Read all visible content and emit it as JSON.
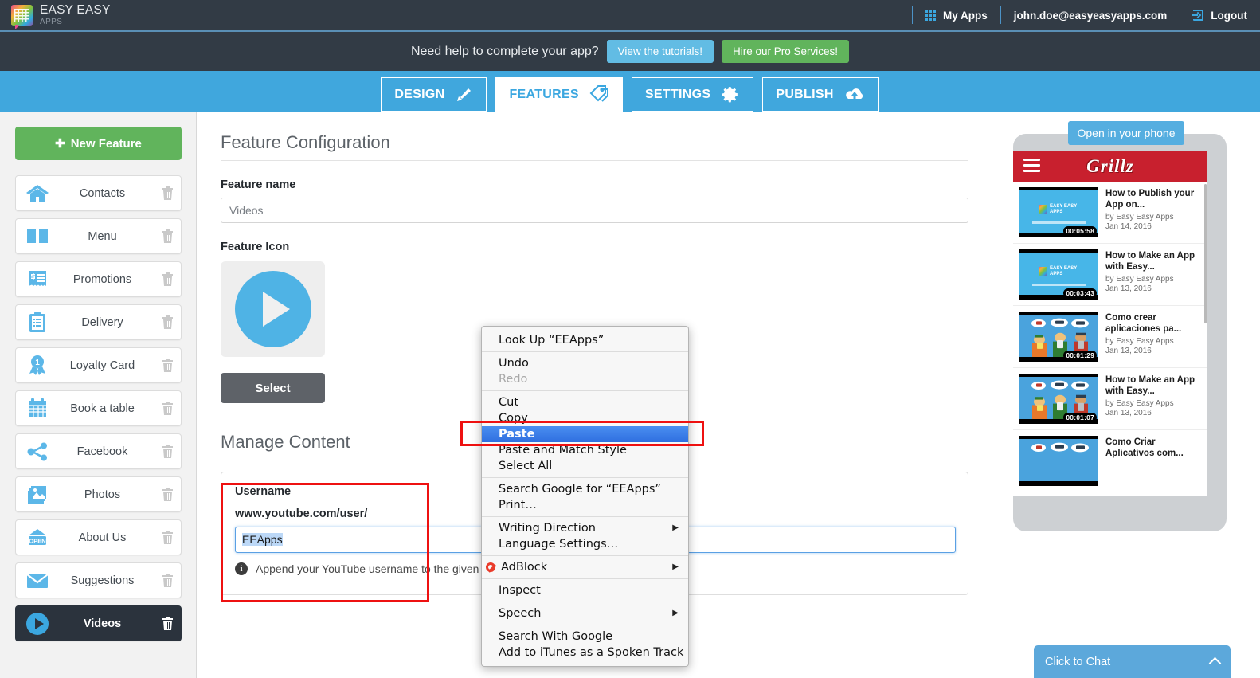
{
  "topbar": {
    "logo": {
      "line1": "EASY EASY",
      "line2": "APPS",
      "icon": "grid-logo-icon"
    },
    "my_apps": "My Apps",
    "my_apps_icon": "apps-grid-icon",
    "account_email": "john.doe@easyeasyapps.com",
    "logout": "Logout",
    "logout_icon": "logout-arrow-icon"
  },
  "helpbar": {
    "prompt": "Need help to complete your app?",
    "tutorials_button": "View the tutorials!",
    "pro_button": "Hire our Pro Services!",
    "tutorials_color": "#62bce4",
    "pro_color": "#61b45c"
  },
  "nav": {
    "tabs": [
      {
        "label": "DESIGN",
        "icon": "paintbrush-icon",
        "active": false
      },
      {
        "label": "FEATURES",
        "icon": "tags-icon",
        "active": true
      },
      {
        "label": "SETTINGS",
        "icon": "gear-icon",
        "active": false
      },
      {
        "label": "PUBLISH",
        "icon": "cloud-upload-icon",
        "active": false
      }
    ],
    "bar_color": "#40a7dd"
  },
  "sidebar": {
    "new_feature_button": "New Feature",
    "items": [
      {
        "label": "Contacts",
        "icon": "home-icon",
        "active": false
      },
      {
        "label": "Menu",
        "icon": "book-icon",
        "active": false
      },
      {
        "label": "Promotions",
        "icon": "receipt-dollar-icon",
        "active": false
      },
      {
        "label": "Delivery",
        "icon": "clipboard-icon",
        "active": false
      },
      {
        "label": "Loyalty Card",
        "icon": "award-ribbon-icon",
        "active": false
      },
      {
        "label": "Book a table",
        "icon": "calendar-icon",
        "active": false
      },
      {
        "label": "Facebook",
        "icon": "share-nodes-icon",
        "active": false
      },
      {
        "label": "Photos",
        "icon": "photos-stack-icon",
        "active": false
      },
      {
        "label": "About Us",
        "icon": "open-sign-icon",
        "active": false
      },
      {
        "label": "Suggestions",
        "icon": "envelope-icon",
        "active": false
      },
      {
        "label": "Videos",
        "icon": "play-circle-icon",
        "active": true
      }
    ],
    "delete_icon": "trash-icon"
  },
  "main": {
    "section_title": "Feature Configuration",
    "feature_name_label": "Feature name",
    "feature_name_value": "Videos",
    "feature_icon_label": "Feature Icon",
    "feature_icon": "play-circle-icon",
    "select_button": "Select",
    "manage_title": "Manage Content",
    "username_label": "Username",
    "username_url_prefix": "www.youtube.com/user/",
    "username_value": "EEApps",
    "hint_icon": "info-icon",
    "hint_text": "Append your YouTube username to the given url above."
  },
  "preview": {
    "open_button": "Open in your phone",
    "app_name": "Grillz",
    "menu_icon": "hamburger-icon",
    "header_color": "#c8202e",
    "videos": [
      {
        "title": "How to Publish your App on...",
        "author": "by Easy Easy Apps",
        "date": "Jan 14, 2016",
        "duration": "00:05:58",
        "thumb": "easy-easy-apps-slide"
      },
      {
        "title": "How to Make an App with Easy...",
        "author": "by Easy Easy Apps",
        "date": "Jan 13, 2016",
        "duration": "00:03:43",
        "thumb": "easy-easy-apps-slide"
      },
      {
        "title": "Como crear aplicaciones pa...",
        "author": "by Easy Easy Apps",
        "date": "Jan 13, 2016",
        "duration": "00:01:29",
        "thumb": "people-phones"
      },
      {
        "title": "How to Make an App with Easy...",
        "author": "by Easy Easy Apps",
        "date": "Jan 13, 2016",
        "duration": "00:01:07",
        "thumb": "people-phones"
      },
      {
        "title": "Como Criar Aplicativos com...",
        "author": "",
        "date": "",
        "duration": "",
        "thumb": "people-phones"
      }
    ]
  },
  "chat": {
    "label": "Click to Chat",
    "icon": "chevron-up-icon",
    "color": "#5ca8db"
  },
  "context_menu": {
    "groups": [
      {
        "items": [
          {
            "label": "Look Up “EEApps”",
            "state": "normal"
          }
        ]
      },
      {
        "items": [
          {
            "label": "Undo",
            "state": "normal"
          },
          {
            "label": "Redo",
            "state": "disabled"
          }
        ]
      },
      {
        "items": [
          {
            "label": "Cut",
            "state": "normal"
          },
          {
            "label": "Copy",
            "state": "normal"
          },
          {
            "label": "Paste",
            "state": "highlighted"
          },
          {
            "label": "Paste and Match Style",
            "state": "normal"
          },
          {
            "label": "Select All",
            "state": "normal"
          }
        ]
      },
      {
        "items": [
          {
            "label": "Search Google for “EEApps”",
            "state": "normal"
          },
          {
            "label": "Print…",
            "state": "normal"
          }
        ]
      },
      {
        "items": [
          {
            "label": "Writing Direction",
            "state": "normal",
            "submenu": true
          },
          {
            "label": "Language Settings…",
            "state": "normal"
          }
        ]
      },
      {
        "items": [
          {
            "label": "AdBlock",
            "state": "normal",
            "submenu": true,
            "icon": "adblock-icon"
          }
        ]
      },
      {
        "items": [
          {
            "label": "Inspect",
            "state": "normal"
          }
        ]
      },
      {
        "items": [
          {
            "label": "Speech",
            "state": "normal",
            "submenu": true
          }
        ]
      },
      {
        "items": [
          {
            "label": "Search With Google",
            "state": "normal"
          },
          {
            "label": "Add to iTunes as a Spoken Track",
            "state": "normal"
          }
        ]
      }
    ],
    "highlight_color": "#2f6fe0"
  },
  "annotations": {
    "color": "#ee1111",
    "boxes": [
      {
        "name": "paste-menu-item-highlight"
      },
      {
        "name": "username-field-highlight"
      }
    ]
  }
}
